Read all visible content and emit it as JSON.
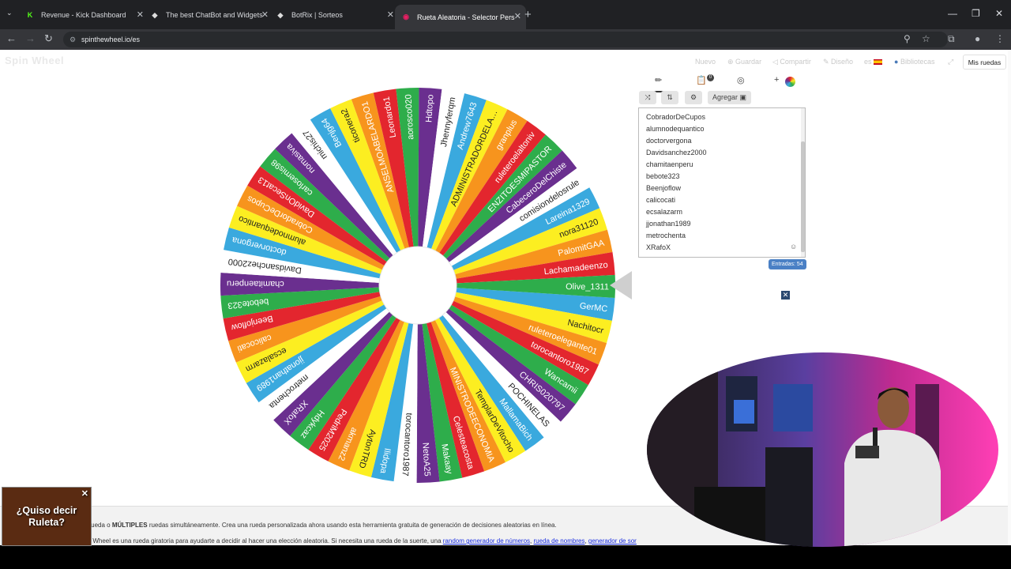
{
  "tabs": [
    {
      "title": "Revenue - Kick Dashboard",
      "favicon": "K",
      "active": false
    },
    {
      "title": "The best ChatBot and Widgets",
      "favicon": "◆",
      "active": false
    },
    {
      "title": "BotRix | Sorteos",
      "favicon": "◆",
      "active": false
    },
    {
      "title": "Rueta Aleatoria - Selector Pers",
      "favicon": "◉",
      "active": true
    }
  ],
  "address": {
    "url": "spinthewheel.io/es"
  },
  "site": {
    "logo": "Spin Wheel",
    "menu": [
      {
        "label": "Nuevo",
        "icon": "new-icon"
      },
      {
        "label": "Guardar",
        "icon": "save-icon"
      },
      {
        "label": "Compartir",
        "icon": "share-icon"
      },
      {
        "label": "Diseño",
        "icon": "design-icon"
      },
      {
        "label": "es",
        "icon": "flag-es-icon"
      },
      {
        "label": "Bibliotecas",
        "icon": "globe-icon"
      }
    ],
    "my_wheels": "Mis ruedas"
  },
  "editor": {
    "add_label": "Agregar",
    "list_badge": "0",
    "entries_count": "Entradas: 54",
    "visible_entries": [
      "CobradorDeCupos",
      "alumnodequantico",
      "doctorvergona",
      "Davidsanchez2000",
      "chamitaenperu",
      "bebote323",
      "Beenjoflow",
      "calicocati",
      "ecsalazarm",
      "jjonathan1989",
      "metrochenta",
      "XRafoX"
    ]
  },
  "wheel": {
    "colors": [
      "#3aa9de",
      "#fcee21",
      "#f7941d",
      "#e3262e",
      "#2ead4b",
      "#6a2f8f",
      "#ffffff"
    ],
    "segments": [
      "GerMC",
      "Nachitocr",
      "ruleteroelegante01",
      "torocantoro1987",
      "Wancamii",
      "CHRIS020797",
      "POCHINELAS",
      "MallamaBich",
      "TemplarDeVitocho",
      "MINISTRODEECONOMIA",
      "Celesteacosta",
      "Makaay",
      "NetoA25",
      "torocantoro1987",
      "Ilidopa",
      "AytonTRD",
      "akmanz2",
      "PedriM2025",
      "Hdykcaz",
      "XRafoX",
      "metrochenta",
      "jjonathan1989",
      "ecsalazarm",
      "calicocati",
      "Beenjoflow",
      "bebote323",
      "chamitaenperu",
      "Davidsanchez2000",
      "doctorvergona",
      "alumnodequantico",
      "CobradorDeCupos",
      "DavidOnSecat13",
      "carlosemis98",
      "nomasiva",
      "michis27",
      "Benjg64",
      "ticonera2",
      "ANSELMOABELARDO1",
      "Leonardo1",
      "aorosco020",
      "Hdtopo",
      "Jhennyferqm",
      "Andrew7643",
      "ADMINISTRADORDELASALAS",
      "granplus",
      "ruleteroelaltoniv",
      "ENZITOESMIPASTOR",
      "CabeceroDelChiste",
      "comisiondelosrule",
      "Lareina1329",
      "nora31120",
      "PalomitGAA",
      "Lachamadeenzo",
      "Olive_1311"
    ]
  },
  "footer": {
    "line1_a": "la rueda o",
    "line1_b": "MÚLTIPLES",
    "line1_c": "ruedas simultáneamente. Crea una rueda personalizada ahora usando esta herramienta gratuita de generación de decisiones aleatorias en línea.",
    "line2_a": "the Wheel es una rueda giratoria para ayudarte a decidir al hacer una elección aleatoria. Si necesita una rueda de la suerte, una",
    "link1": "random generador de números",
    "link2": "rueda de nombres",
    "link3": "generador de sor"
  },
  "popup": {
    "title": "¿Quiso decir Ruleta?"
  }
}
